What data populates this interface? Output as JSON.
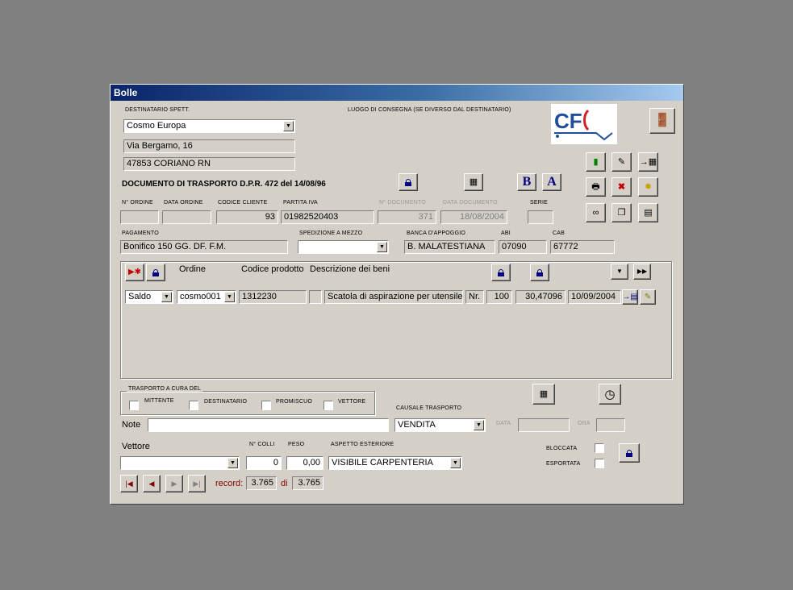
{
  "window": {
    "title": "Bolle"
  },
  "destinatario": {
    "label": "DESTINATARIO SPETT.",
    "name": "Cosmo Europa",
    "address": "Via Bergamo, 16",
    "city": "47853 CORIANO RN"
  },
  "luogo": {
    "label": "LUOGO DI CONSEGNA (SE DIVERSO DAL DESTINATARIO)"
  },
  "logo": {
    "text": "CF",
    "brand_color": "#1f4e9c",
    "accent_color": "#d42020"
  },
  "doc": {
    "heading": "DOCUMENTO DI TRASPORTO D.P.R. 472 del 14/08/96"
  },
  "fonts": {
    "bold_btn": "B",
    "italic_btn": "A"
  },
  "ordine": {
    "n_ordine_label": "N° ORDINE",
    "n_ordine": "",
    "data_ordine_label": "DATA ORDINE",
    "data_ordine": "",
    "codice_cliente_label": "CODICE CLIENTE",
    "codice_cliente": "93",
    "partita_iva_label": "PARTITA IVA",
    "partita_iva": "01982520403",
    "n_documento_label": "N° DOCUMENTO",
    "n_documento": "371",
    "data_documento_label": "DATA DOCUMENTO",
    "data_documento": "18/08/2004",
    "serie_label": "SERIE",
    "serie": ""
  },
  "pagamento": {
    "label": "PAGAMENTO",
    "value": "Bonifico 150 GG. DF. F.M.",
    "spedizione_label": "SPEDIZIONE A MEZZO",
    "spedizione": "",
    "banca_label": "BANCA D'APPOGGIO",
    "banca": "B. MALATESTIANA",
    "abi_label": "ABI",
    "abi": "07090",
    "cab_label": "CAB",
    "cab": "67772"
  },
  "righe": {
    "col_ordine": "Ordine",
    "col_codice": "Codice prodotto",
    "col_descrizione": "Descrizione dei beni",
    "row": {
      "tipo": "Saldo",
      "ordine": "cosmo001",
      "codice": "1312230",
      "flag": "",
      "descrizione": "Scatola di aspirazione per utensile c",
      "um": "Nr.",
      "qta": "100",
      "prezzo": "30,47096",
      "data": "10/09/2004"
    }
  },
  "trasporto": {
    "label": "TRASPORTO A CURA DEL",
    "mittente": "MITTENTE",
    "destinatario": "DESTINATARIO",
    "promiscuo": "PROMISCUO",
    "vettore": "VETTORE"
  },
  "causale": {
    "label": "CAUSALE TRASPORTO",
    "value": "VENDITA",
    "data_label": "DATA",
    "data": "",
    "ora_label": "ORA",
    "ora": ""
  },
  "note": {
    "label": "Note",
    "value": ""
  },
  "vettore": {
    "label": "Vettore",
    "value": "",
    "colli_label": "N° COLLI",
    "colli": "0",
    "peso_label": "PESO",
    "peso": "0,00",
    "aspetto_label": "ASPETTO ESTERIORE",
    "aspetto": "VISIBILE CARPENTERIA"
  },
  "stato": {
    "bloccata": "BLOCCATA",
    "esportata": "ESPORTATA"
  },
  "nav": {
    "record_label": "record:",
    "current": "3.765",
    "of_label": "di",
    "total": "3.765"
  }
}
